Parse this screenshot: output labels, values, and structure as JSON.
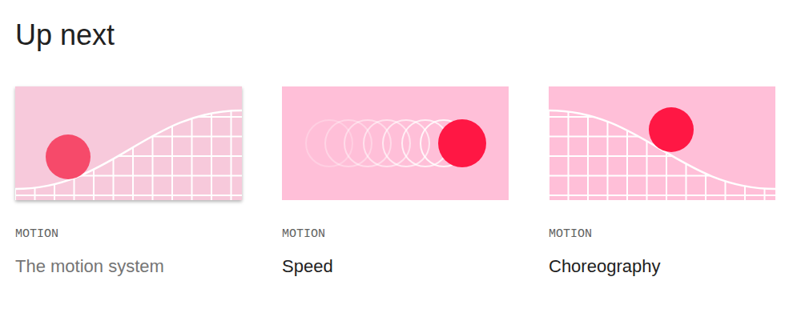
{
  "heading": "Up next",
  "cards": [
    {
      "category": "MOTION",
      "title": "The motion system",
      "kind": "rise",
      "hovered": true
    },
    {
      "category": "MOTION",
      "title": "Speed",
      "kind": "trail",
      "hovered": false
    },
    {
      "category": "MOTION",
      "title": "Choreography",
      "kind": "fall",
      "hovered": false
    }
  ]
}
